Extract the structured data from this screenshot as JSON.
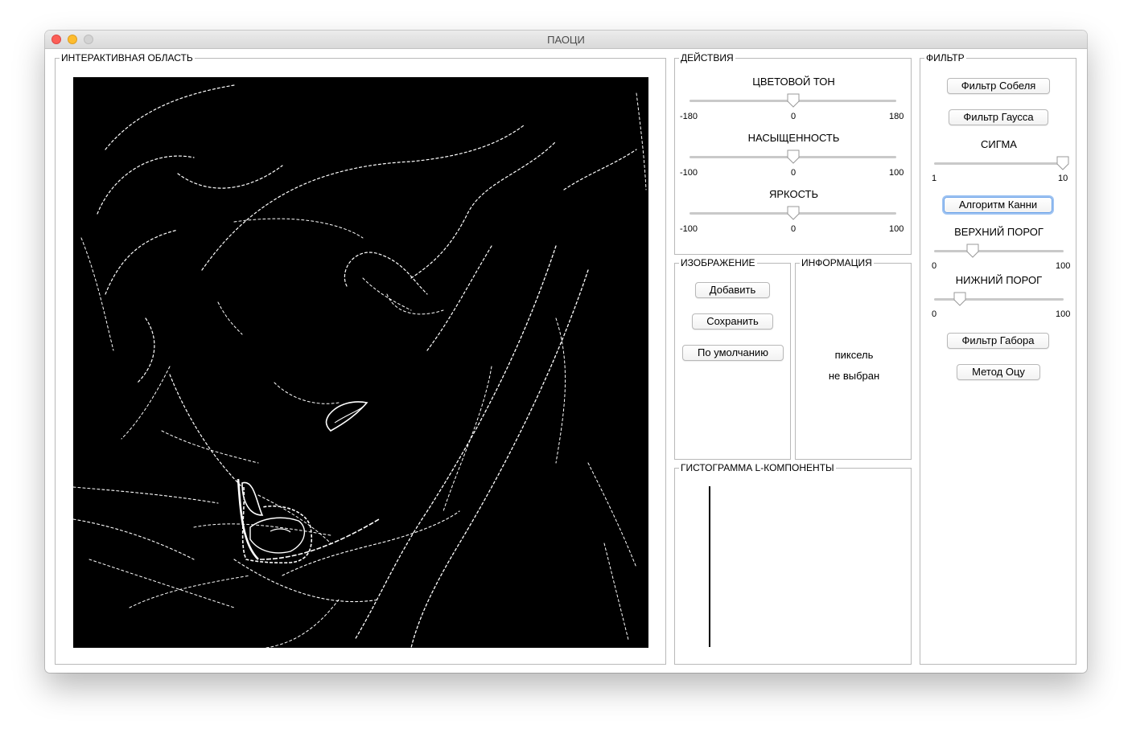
{
  "window": {
    "title": "ПАОЦИ"
  },
  "interactive": {
    "label": "ИНТЕРАКТИВНАЯ ОБЛАСТЬ"
  },
  "actions": {
    "label": "ДЕЙСТВИЯ",
    "hue": {
      "label": "ЦВЕТОВОЙ ТОН",
      "min": "-180",
      "mid": "0",
      "max": "180",
      "value": 0
    },
    "saturation": {
      "label": "НАСЫЩЕННОСТЬ",
      "min": "-100",
      "mid": "0",
      "max": "100",
      "value": 0
    },
    "brightness": {
      "label": "ЯРКОСТЬ",
      "min": "-100",
      "mid": "0",
      "max": "100",
      "value": 0
    }
  },
  "image": {
    "label": "ИЗОБРАЖЕНИЕ",
    "add": "Добавить",
    "save": "Сохранить",
    "default": "По умолчанию"
  },
  "info": {
    "label": "ИНФОРМАЦИЯ",
    "line1": "пиксель",
    "line2": "не выбран"
  },
  "histogram": {
    "label": "ГИСТОГРАММА L-КОМПОНЕНТЫ"
  },
  "filter": {
    "label": "ФИЛЬТР",
    "sobel": "Фильтр Собеля",
    "gauss": "Фильтр Гаусса",
    "sigma": {
      "label": "СИГМА",
      "min": "1",
      "max": "10",
      "value": 10
    },
    "canny": "Алгоритм Канни",
    "upper": {
      "label": "ВЕРХНИЙ ПОРОГ",
      "min": "0",
      "max": "100",
      "value": 30
    },
    "lower": {
      "label": "НИЖНИЙ ПОРОГ",
      "min": "0",
      "max": "100",
      "value": 20
    },
    "gabor": "Фильтр Габора",
    "otsu": "Метод Оцу"
  }
}
